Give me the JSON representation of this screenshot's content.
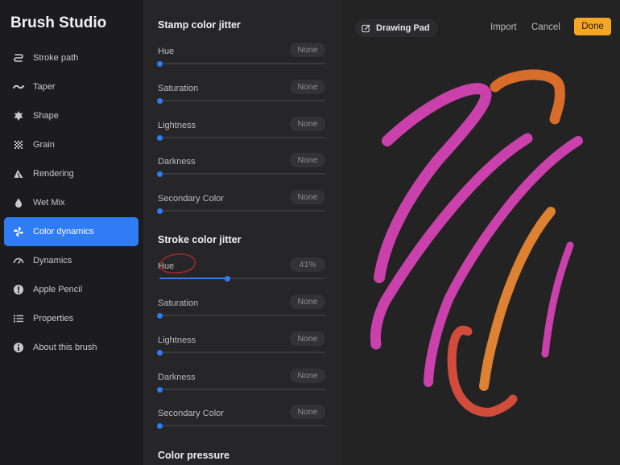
{
  "sidebar": {
    "title": "Brush Studio",
    "items": [
      {
        "label": "Stroke path",
        "icon": "stroke-path-icon"
      },
      {
        "label": "Taper",
        "icon": "taper-icon"
      },
      {
        "label": "Shape",
        "icon": "shape-icon"
      },
      {
        "label": "Grain",
        "icon": "grain-icon"
      },
      {
        "label": "Rendering",
        "icon": "rendering-icon"
      },
      {
        "label": "Wet Mix",
        "icon": "wet-mix-icon"
      },
      {
        "label": "Color dynamics",
        "icon": "color-dynamics-icon",
        "active": true
      },
      {
        "label": "Dynamics",
        "icon": "dynamics-icon"
      },
      {
        "label": "Apple Pencil",
        "icon": "apple-pencil-icon"
      },
      {
        "label": "Properties",
        "icon": "properties-icon"
      },
      {
        "label": "About this brush",
        "icon": "info-icon"
      }
    ]
  },
  "panel": {
    "stamp": {
      "title": "Stamp color jitter",
      "rows": [
        {
          "label": "Hue",
          "value": "None",
          "level": 0
        },
        {
          "label": "Saturation",
          "value": "None",
          "level": 0
        },
        {
          "label": "Lightness",
          "value": "None",
          "level": 0
        },
        {
          "label": "Darkness",
          "value": "None",
          "level": 0
        },
        {
          "label": "Secondary Color",
          "value": "None",
          "level": 0
        }
      ]
    },
    "stroke": {
      "title": "Stroke color jitter",
      "rows": [
        {
          "label": "Hue",
          "value": "41%",
          "level": 0.41
        },
        {
          "label": "Saturation",
          "value": "None",
          "level": 0
        },
        {
          "label": "Lightness",
          "value": "None",
          "level": 0
        },
        {
          "label": "Darkness",
          "value": "None",
          "level": 0
        },
        {
          "label": "Secondary Color",
          "value": "None",
          "level": 0
        }
      ]
    },
    "pressure": {
      "title": "Color pressure"
    }
  },
  "pad": {
    "title": "Drawing Pad",
    "import_label": "Import",
    "cancel_label": "Cancel",
    "done_label": "Done"
  },
  "colors": {
    "accent": "#2f7cf6",
    "done": "#f5a623",
    "stroke_magenta": "#d944b8",
    "stroke_orange": "#ee8a34",
    "stroke_red": "#e2503f"
  }
}
